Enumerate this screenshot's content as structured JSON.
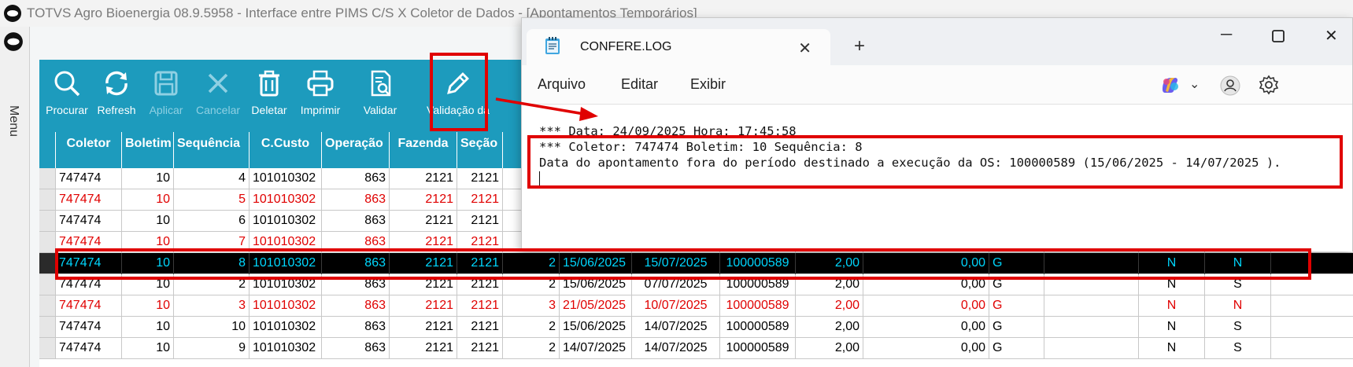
{
  "app": {
    "title": "TOTVS Agro Bioenergia 08.9.5958 - Interface entre PIMS C/S X Coletor de Dados - [Apontamentos Temporários]",
    "menu_label": "Menu"
  },
  "toolbar": {
    "procurar": "Procurar",
    "refresh": "Refresh",
    "aplicar": "Aplicar",
    "cancelar": "Cancelar",
    "deletar": "Deletar",
    "imprimir": "Imprimir",
    "validar": "Validar",
    "validacao": "Validação da"
  },
  "grid": {
    "columns": [
      "Coletor",
      "Boletim",
      "Sequência",
      "C.Custo",
      "Operação",
      "Fazenda",
      "Seção"
    ],
    "rows": [
      {
        "style": "normal",
        "cells": [
          "747474",
          "10",
          "4",
          "101010302",
          "863",
          "2121",
          "2121",
          "",
          "",
          "",
          "",
          "",
          "",
          "",
          "",
          "",
          "",
          ""
        ]
      },
      {
        "style": "red",
        "cells": [
          "747474",
          "10",
          "5",
          "101010302",
          "863",
          "2121",
          "2121",
          "",
          "",
          "",
          "",
          "",
          "",
          "",
          "",
          "",
          "",
          ""
        ]
      },
      {
        "style": "normal",
        "cells": [
          "747474",
          "10",
          "6",
          "101010302",
          "863",
          "2121",
          "2121",
          "",
          "",
          "",
          "",
          "",
          "",
          "",
          "",
          "",
          "",
          ""
        ]
      },
      {
        "style": "red",
        "cells": [
          "747474",
          "10",
          "7",
          "101010302",
          "863",
          "2121",
          "2121",
          "",
          "",
          "",
          "",
          "",
          "",
          "",
          "",
          "",
          "",
          ""
        ]
      },
      {
        "style": "sel",
        "cells": [
          "747474",
          "10",
          "8",
          "101010302",
          "863",
          "2121",
          "2121",
          "2",
          "15/06/2025",
          "15/07/2025",
          "100000589",
          "2,00",
          "0,00",
          "G",
          "",
          "N",
          "N",
          ""
        ]
      },
      {
        "style": "normal",
        "cells": [
          "747474",
          "10",
          "2",
          "101010302",
          "863",
          "2121",
          "2121",
          "2",
          "15/06/2025",
          "07/07/2025",
          "100000589",
          "2,00",
          "0,00",
          "G",
          "",
          "N",
          "S",
          ""
        ]
      },
      {
        "style": "red",
        "cells": [
          "747474",
          "10",
          "3",
          "101010302",
          "863",
          "2121",
          "2121",
          "3",
          "21/05/2025",
          "10/07/2025",
          "100000589",
          "2,00",
          "0,00",
          "G",
          "",
          "N",
          "N",
          ""
        ]
      },
      {
        "style": "normal",
        "cells": [
          "747474",
          "10",
          "10",
          "101010302",
          "863",
          "2121",
          "2121",
          "2",
          "15/06/2025",
          "14/07/2025",
          "100000589",
          "2,00",
          "0,00",
          "G",
          "",
          "N",
          "S",
          ""
        ]
      },
      {
        "style": "normal",
        "cells": [
          "747474",
          "10",
          "9",
          "101010302",
          "863",
          "2121",
          "2121",
          "2",
          "14/07/2025",
          "14/07/2025",
          "100000589",
          "2,00",
          "0,00",
          "G",
          "",
          "N",
          "S",
          ""
        ]
      }
    ]
  },
  "notepad": {
    "tab_title": "CONFERE.LOG",
    "menu": [
      "Arquivo",
      "Editar",
      "Exibir"
    ],
    "lines": [
      "*** Data: 24/09/2025 Hora: 17:45:58",
      "*** Coletor: 747474 Boletim: 10 Sequência: 8",
      "Data do apontamento fora do período destinado a execução da OS: 100000589 (15/06/2025 - 14/07/2025 )."
    ]
  },
  "colors": {
    "toolbar_bg": "#1d9bbd",
    "error_text": "#e00000",
    "selected_text": "#00d8ff",
    "annotation": "#e00000"
  }
}
